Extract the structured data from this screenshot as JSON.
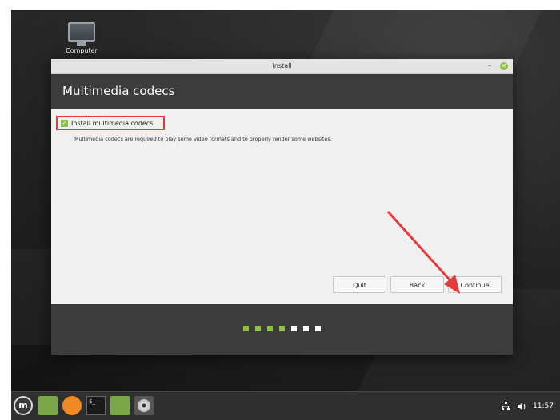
{
  "desktop": {
    "icon_label": "Computer"
  },
  "window": {
    "title": "Install",
    "minimize_glyph": "–",
    "close_glyph": "✕",
    "header": "Multimedia codecs",
    "checkbox_label": "Install multimedia codecs",
    "checkbox_checked": true,
    "description": "Multimedia codecs are required to play some video formats and to properly render some websites.",
    "buttons": {
      "quit": "Quit",
      "back": "Back",
      "continue": "Continue"
    },
    "progress": {
      "total_steps": 7,
      "completed_steps": 4,
      "completed_color": "#8fbf4a",
      "remaining_color": "#ffffff"
    }
  },
  "taskbar": {
    "menu_icon": "linux-mint-logo-icon",
    "apps": [
      "folder-icon",
      "firefox-icon",
      "terminal-icon",
      "files-icon",
      "disc-installer-icon"
    ],
    "terminal_glyph": "$_",
    "clock": "11:57",
    "tray_icons": [
      "network-icon",
      "volume-icon"
    ]
  },
  "colors": {
    "accent_green": "#8fbf4a",
    "highlight_red": "#e23c3c",
    "header_dark": "#3c3c3c"
  }
}
